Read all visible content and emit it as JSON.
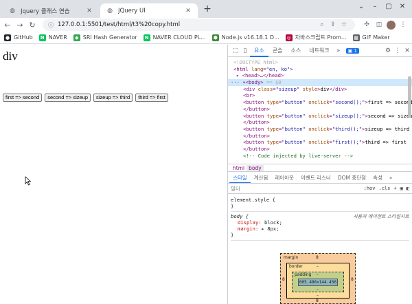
{
  "tabs": [
    {
      "title": "Jquery 클래스 연습"
    },
    {
      "title": "JQuery UI"
    }
  ],
  "omnibox": {
    "url": "127.0.0.1:5501/test/html/t3%20copy.html"
  },
  "bookmarks": [
    {
      "label": "GitHub",
      "color": "#24292e",
      "glyph": "●"
    },
    {
      "label": "NAVER",
      "color": "#03c75a",
      "glyph": "N"
    },
    {
      "label": "SRI Hash Generator",
      "color": "#34a853",
      "glyph": "◆"
    },
    {
      "label": "NAVER CLOUD PL...",
      "color": "#03c75a",
      "glyph": "N"
    },
    {
      "label": "Node.js v16.18.1 D...",
      "color": "#3c873a",
      "glyph": "⬢"
    },
    {
      "label": "자바스크립트 Prom...",
      "color": "#b8003c",
      "glyph": "◎"
    },
    {
      "label": "GIF Maker",
      "color": "#5f6368",
      "glyph": "▦"
    }
  ],
  "page": {
    "div_text": "div",
    "buttons": [
      "first => second",
      "second => sizeup",
      "sizeup => third",
      "third => first"
    ]
  },
  "devtools": {
    "tabs": [
      "요소",
      "콘솔",
      "소스",
      "네트워크"
    ],
    "badge": "1",
    "breadcrumbs": [
      "html",
      "body"
    ],
    "style_tabs": [
      "스타일",
      "계산됨",
      "레이아웃",
      "이벤트 리스너",
      "DOM 중단점",
      "속성"
    ],
    "filter_placeholder": "필터",
    "hov": ":hov",
    "cls": ".cls",
    "element_style": "element.style {",
    "close_brace": "}",
    "body_rule": {
      "selector": "body {",
      "source": "사용자 에이전트 스타일시트",
      "props": [
        {
          "name": "display",
          "value": "block;"
        },
        {
          "name": "margin",
          "value": "▸ 8px;"
        }
      ]
    },
    "box": {
      "margin_label": "margin",
      "margin_val": "8",
      "border_label": "border",
      "border_val": "–",
      "padding_label": "padding",
      "padding_val": "–",
      "content": "605.486×144.456"
    }
  }
}
